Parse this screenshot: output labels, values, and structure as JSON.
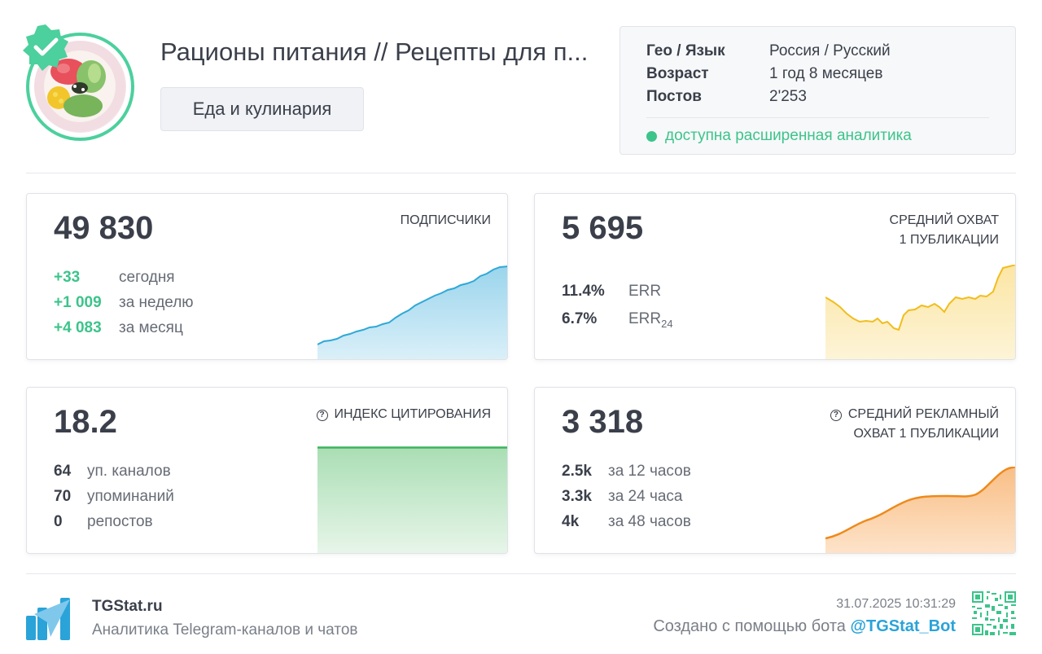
{
  "channel": {
    "title": "Рационы питания // Рецепты для п...",
    "category": "Еда и кулинария"
  },
  "info": {
    "rows": [
      {
        "key": "Гео / Язык",
        "value": "Россия / Русский"
      },
      {
        "key": "Возраст",
        "value": "1 год 8 месяцев"
      },
      {
        "key": "Постов",
        "value": "2'253"
      }
    ],
    "advanced": "доступна расширенная аналитика"
  },
  "subscribers": {
    "value": "49 830",
    "label": "ПОДПИСЧИКИ",
    "rows": [
      {
        "n": "+33",
        "t": "сегодня"
      },
      {
        "n": "+1 009",
        "t": "за неделю"
      },
      {
        "n": "+4 083",
        "t": "за месяц"
      }
    ]
  },
  "reach": {
    "value": "5 695",
    "label_line1": "СРЕДНИЙ ОХВАТ",
    "label_line2": "1 ПУБЛИКАЦИИ",
    "rows": [
      {
        "n": "11.4%",
        "t": "ERR",
        "sub": ""
      },
      {
        "n": "6.7%",
        "t": "ERR",
        "sub": "24"
      }
    ]
  },
  "citation": {
    "value": "18.2",
    "label": "ИНДЕКС ЦИТИРОВАНИЯ",
    "rows": [
      {
        "n": "64",
        "t": "уп. каналов"
      },
      {
        "n": "70",
        "t": "упоминаний"
      },
      {
        "n": "0",
        "t": "репостов"
      }
    ]
  },
  "ad_reach": {
    "value": "3 318",
    "label_line1": "СРЕДНИЙ РЕКЛАМНЫЙ",
    "label_line2": "ОХВАТ 1 ПУБЛИКАЦИИ",
    "rows": [
      {
        "n": "2.5k",
        "t": "за 12 часов"
      },
      {
        "n": "3.3k",
        "t": "за 24 часа"
      },
      {
        "n": "4k",
        "t": "за 48 часов"
      }
    ]
  },
  "footer": {
    "site": "TGStat.ru",
    "tagline": "Аналитика Telegram-каналов и чатов",
    "timestamp": "31.07.2025 10:31:29",
    "made_by": "Создано с помощью бота",
    "bot": "@TGStat_Bot"
  },
  "colors": {
    "accent_green": "#3cc48a",
    "subscribers_line": "#2fa8d6",
    "reach_line": "#f2bd1d",
    "citation_line": "#3cb35c",
    "ad_reach_line": "#ee8a1c",
    "bot_link": "#2aa3d9"
  }
}
